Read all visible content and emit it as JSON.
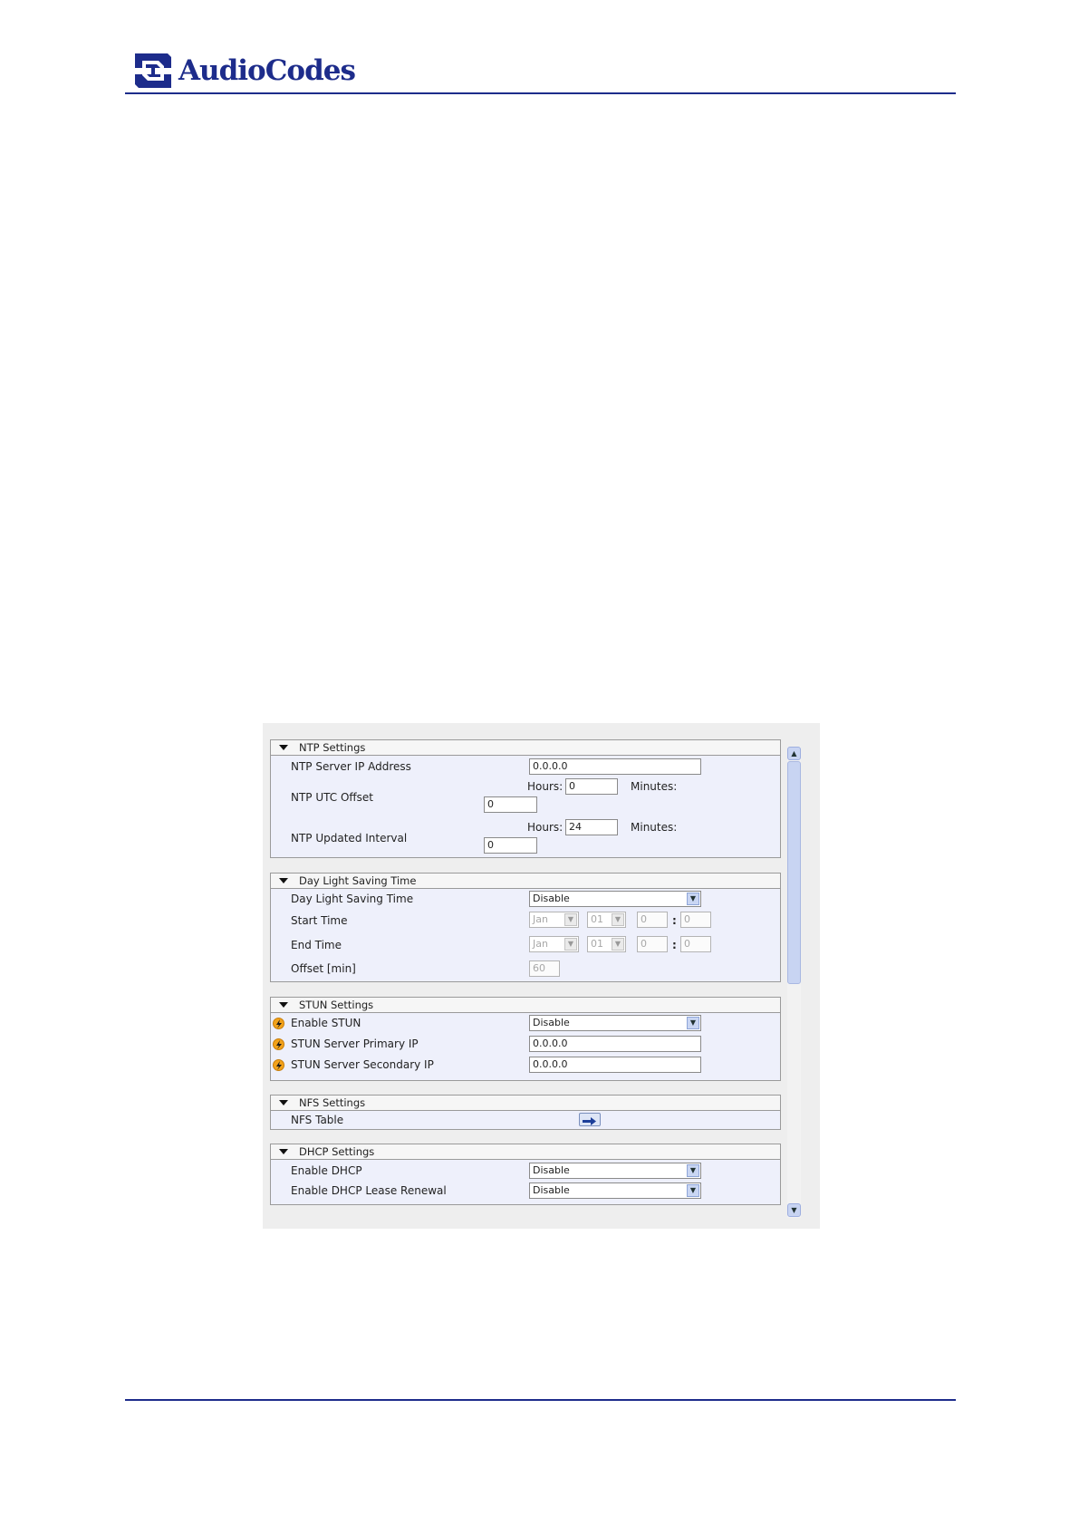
{
  "doc": {
    "logo_text": "AudioCodes"
  },
  "ntp": {
    "section_title": "NTP Settings",
    "server_ip_label": "NTP Server IP Address",
    "server_ip_value": "0.0.0.0",
    "utc_offset_label": "NTP UTC Offset",
    "hours_label": "Hours:",
    "minutes_label": "Minutes:",
    "utc_hours": "0",
    "utc_minutes": "0",
    "interval_label": "NTP Updated Interval",
    "interval_hours": "24",
    "interval_minutes": "0"
  },
  "dst": {
    "section_title": "Day Light Saving Time",
    "mode_label": "Day Light Saving Time",
    "mode_value": "Disable",
    "start_label": "Start Time",
    "end_label": "End Time",
    "month": "Jan",
    "day": "01",
    "hour": "0",
    "minute": "0",
    "colon": ":",
    "offset_label": "Offset [min]",
    "offset_value": "60"
  },
  "stun": {
    "section_title": "STUN Settings",
    "enable_label": "Enable STUN",
    "enable_value": "Disable",
    "primary_label": "STUN Server Primary IP",
    "primary_value": "0.0.0.0",
    "secondary_label": "STUN Server Secondary IP",
    "secondary_value": "0.0.0.0"
  },
  "nfs": {
    "section_title": "NFS Settings",
    "table_label": "NFS Table"
  },
  "dhcp": {
    "section_title": "DHCP Settings",
    "enable_label": "Enable DHCP",
    "enable_value": "Disable",
    "renewal_label": "Enable DHCP Lease Renewal",
    "renewal_value": "Disable"
  },
  "icons": [
    "collapse-triangle-icon",
    "dropdown-arrow-icon",
    "lightning-bolt-icon",
    "arrow-right-icon",
    "scroll-up-icon",
    "scroll-down-icon"
  ],
  "colors": {
    "brand": "#1d2c8b",
    "panel_bg": "#eef0fb",
    "bolt": "#f2a21b"
  }
}
